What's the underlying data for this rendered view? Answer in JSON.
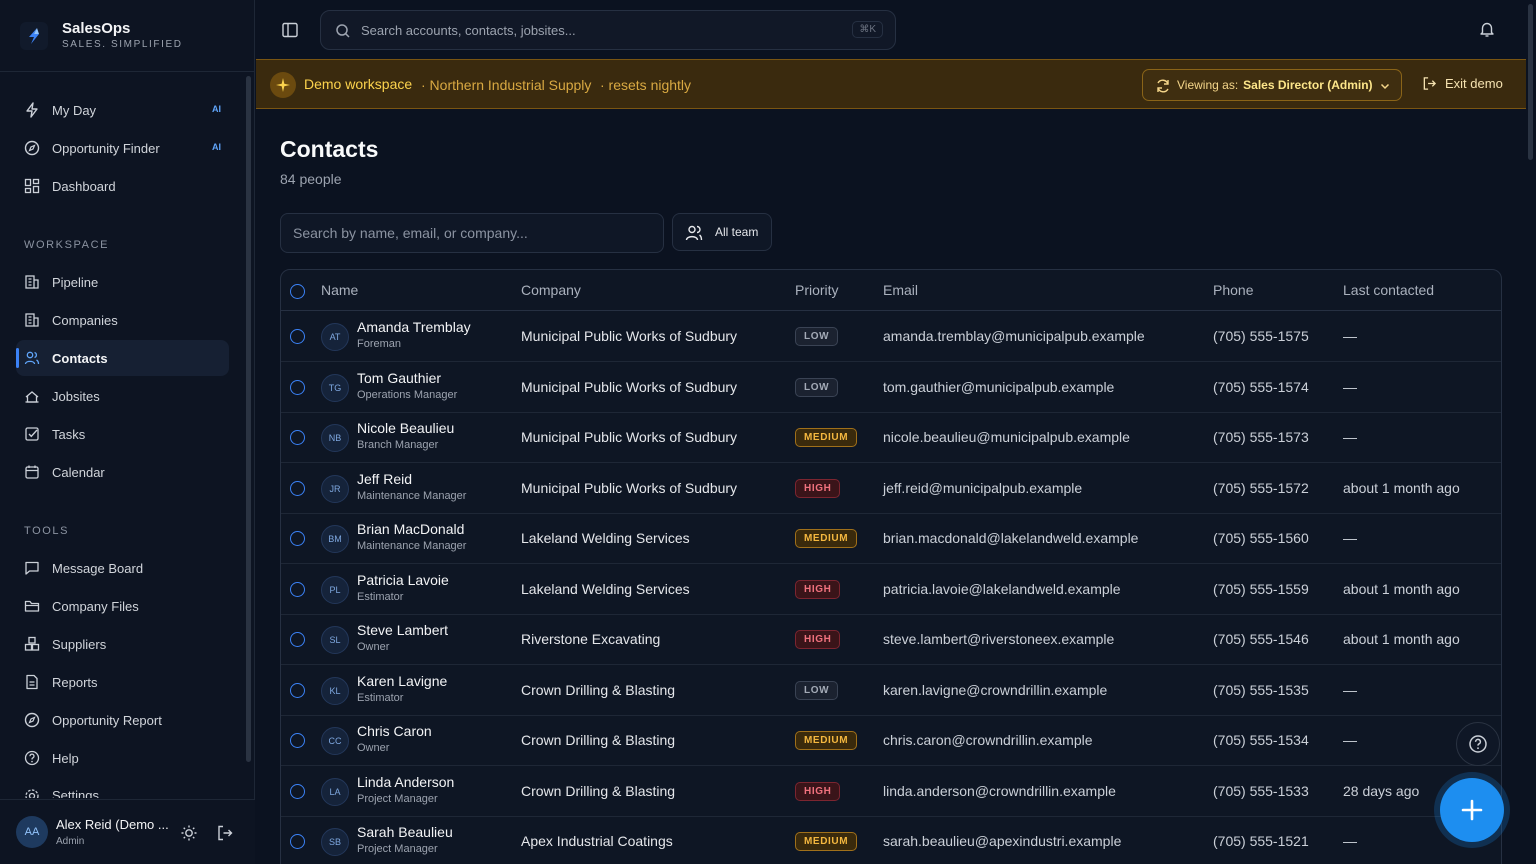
{
  "brand": {
    "name": "SalesOps",
    "tagline": "SALES. SIMPLIFIED"
  },
  "sidebar": {
    "top_items": [
      {
        "label": "My Day",
        "badge": "AI",
        "icon": "lightning-icon"
      },
      {
        "label": "Opportunity Finder",
        "badge": "AI",
        "icon": "compass-icon"
      },
      {
        "label": "Dashboard",
        "icon": "grid-icon"
      }
    ],
    "workspace_label": "WORKSPACE",
    "workspace_items": [
      {
        "label": "Pipeline",
        "icon": "building-icon"
      },
      {
        "label": "Companies",
        "icon": "building-icon"
      },
      {
        "label": "Contacts",
        "icon": "users-icon",
        "active": true
      },
      {
        "label": "Jobsites",
        "icon": "map-pin-icon"
      },
      {
        "label": "Tasks",
        "icon": "checkbox-icon"
      },
      {
        "label": "Calendar",
        "icon": "calendar-icon"
      }
    ],
    "tools_label": "TOOLS",
    "tools_items": [
      {
        "label": "Message Board",
        "icon": "message-icon"
      },
      {
        "label": "Company Files",
        "icon": "folder-icon"
      },
      {
        "label": "Suppliers",
        "icon": "boxes-icon"
      },
      {
        "label": "Reports",
        "icon": "file-icon"
      },
      {
        "label": "Opportunity Report",
        "icon": "compass-icon"
      },
      {
        "label": "Help",
        "icon": "help-icon"
      },
      {
        "label": "Settings",
        "icon": "gear-icon"
      }
    ],
    "user": {
      "initials": "AA",
      "name": "Alex Reid (Demo ...",
      "role": "Admin"
    }
  },
  "topbar": {
    "search_placeholder": "Search accounts, contacts, jobsites...",
    "shortcut": "⌘K"
  },
  "banner": {
    "title": "Demo workspace",
    "org": "· Northern Industrial Supply",
    "note": "· resets nightly",
    "viewing_label": "Viewing as:",
    "viewing_value": "Sales Director (Admin)",
    "exit_label": "Exit demo",
    "accent": "#fcd34d"
  },
  "page": {
    "title": "Contacts",
    "count": "84 people",
    "search_placeholder": "Search by name, email, or company...",
    "team_filter": "All team"
  },
  "table": {
    "columns": [
      "Name",
      "Company",
      "Priority",
      "Email",
      "Phone",
      "Last contacted"
    ],
    "rows": [
      {
        "initials": "AT",
        "name": "Amanda Tremblay",
        "title": "Foreman",
        "company": "Municipal Public Works of Sudbury",
        "priority": "LOW",
        "email": "amanda.tremblay@municipalpub.example",
        "phone": "(705) 555-1575",
        "last": "—"
      },
      {
        "initials": "TG",
        "name": "Tom Gauthier",
        "title": "Operations Manager",
        "company": "Municipal Public Works of Sudbury",
        "priority": "LOW",
        "email": "tom.gauthier@municipalpub.example",
        "phone": "(705) 555-1574",
        "last": "—"
      },
      {
        "initials": "NB",
        "name": "Nicole Beaulieu",
        "title": "Branch Manager",
        "company": "Municipal Public Works of Sudbury",
        "priority": "MEDIUM",
        "email": "nicole.beaulieu@municipalpub.example",
        "phone": "(705) 555-1573",
        "last": "—"
      },
      {
        "initials": "JR",
        "name": "Jeff Reid",
        "title": "Maintenance Manager",
        "company": "Municipal Public Works of Sudbury",
        "priority": "HIGH",
        "email": "jeff.reid@municipalpub.example",
        "phone": "(705) 555-1572",
        "last": "about 1 month ago"
      },
      {
        "initials": "BM",
        "name": "Brian MacDonald",
        "title": "Maintenance Manager",
        "company": "Lakeland Welding Services",
        "priority": "MEDIUM",
        "email": "brian.macdonald@lakelandweld.example",
        "phone": "(705) 555-1560",
        "last": "—"
      },
      {
        "initials": "PL",
        "name": "Patricia Lavoie",
        "title": "Estimator",
        "company": "Lakeland Welding Services",
        "priority": "HIGH",
        "email": "patricia.lavoie@lakelandweld.example",
        "phone": "(705) 555-1559",
        "last": "about 1 month ago"
      },
      {
        "initials": "SL",
        "name": "Steve Lambert",
        "title": "Owner",
        "company": "Riverstone Excavating",
        "priority": "HIGH",
        "email": "steve.lambert@riverstoneex.example",
        "phone": "(705) 555-1546",
        "last": "about 1 month ago"
      },
      {
        "initials": "KL",
        "name": "Karen Lavigne",
        "title": "Estimator",
        "company": "Crown Drilling & Blasting",
        "priority": "LOW",
        "email": "karen.lavigne@crowndrillin.example",
        "phone": "(705) 555-1535",
        "last": "—"
      },
      {
        "initials": "CC",
        "name": "Chris Caron",
        "title": "Owner",
        "company": "Crown Drilling & Blasting",
        "priority": "MEDIUM",
        "email": "chris.caron@crowndrillin.example",
        "phone": "(705) 555-1534",
        "last": "—"
      },
      {
        "initials": "LA",
        "name": "Linda Anderson",
        "title": "Project Manager",
        "company": "Crown Drilling & Blasting",
        "priority": "HIGH",
        "email": "linda.anderson@crowndrillin.example",
        "phone": "(705) 555-1533",
        "last": "28 days ago"
      },
      {
        "initials": "SB",
        "name": "Sarah Beaulieu",
        "title": "Project Manager",
        "company": "Apex Industrial Coatings",
        "priority": "MEDIUM",
        "email": "sarah.beaulieu@apexindustri.example",
        "phone": "(705) 555-1521",
        "last": "—"
      }
    ]
  },
  "colors": {
    "accent": "#3b82f6",
    "fab": "#1d8ef0",
    "background": "#0b1220"
  }
}
